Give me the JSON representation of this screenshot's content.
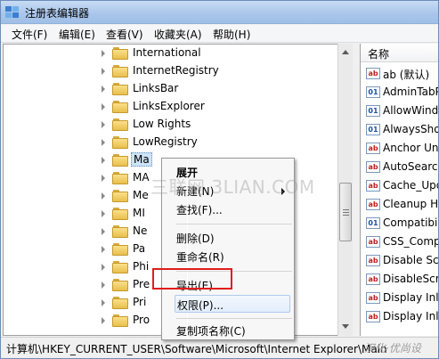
{
  "window": {
    "title": "注册表编辑器"
  },
  "menubar": [
    {
      "label": "文件(F)"
    },
    {
      "label": "编辑(E)"
    },
    {
      "label": "查看(V)"
    },
    {
      "label": "收藏夹(A)"
    },
    {
      "label": "帮助(H)"
    }
  ],
  "tree": {
    "items": [
      {
        "label": "International"
      },
      {
        "label": "InternetRegistry"
      },
      {
        "label": "LinksBar"
      },
      {
        "label": "LinksExplorer"
      },
      {
        "label": "Low Rights"
      },
      {
        "label": "LowRegistry"
      },
      {
        "label": "Main",
        "shown": "Ma",
        "selected": true
      },
      {
        "label": "MA"
      },
      {
        "label": "Me"
      },
      {
        "label": "MI"
      },
      {
        "label": "Ne"
      },
      {
        "label": "Pa"
      },
      {
        "label": "Phi"
      },
      {
        "label": "Pre"
      },
      {
        "label": "Pri"
      },
      {
        "label": "Pro"
      }
    ]
  },
  "list": {
    "header": "名称",
    "values": [
      {
        "label": "ab (默认)",
        "type": "string"
      },
      {
        "label": "AdminTabP",
        "type": "binary"
      },
      {
        "label": "AllowWindo",
        "type": "binary"
      },
      {
        "label": "AlwaysShow",
        "type": "binary"
      },
      {
        "label": "Anchor Unc",
        "type": "string"
      },
      {
        "label": "AutoSearch",
        "type": "string"
      },
      {
        "label": "Cache_Upd",
        "type": "string"
      },
      {
        "label": "Cleanup HT",
        "type": "string"
      },
      {
        "label": "Compatibili",
        "type": "binary"
      },
      {
        "label": "CSS_Compa",
        "type": "string"
      },
      {
        "label": "Disable Scr",
        "type": "string"
      },
      {
        "label": "DisableScrip",
        "type": "string"
      },
      {
        "label": "Display Inlir",
        "type": "string"
      },
      {
        "label": "Display Inlir",
        "type": "string"
      }
    ]
  },
  "context_menu": {
    "items": [
      {
        "label": "展开",
        "bold": true
      },
      {
        "label": "新建(N)",
        "submenu": true
      },
      {
        "label": "查找(F)..."
      },
      {
        "label": "删除(D)"
      },
      {
        "label": "重命名(R)"
      },
      {
        "label": "导出(E)"
      },
      {
        "label": "权限(P)...",
        "highlighted": true
      },
      {
        "label": "复制项名称(C)"
      }
    ]
  },
  "statusbar": {
    "path": "计算机\\HKEY_CURRENT_USER\\Software\\Microsoft\\Internet Explorer\\Main",
    "corner_mark": "汉化·优尚设"
  },
  "watermark": "三联网 3LIAN.COM",
  "colors": {
    "highlight_border": "#e11d1d",
    "title_bar": "#a9c5ea",
    "selection": "#cde3f7"
  }
}
